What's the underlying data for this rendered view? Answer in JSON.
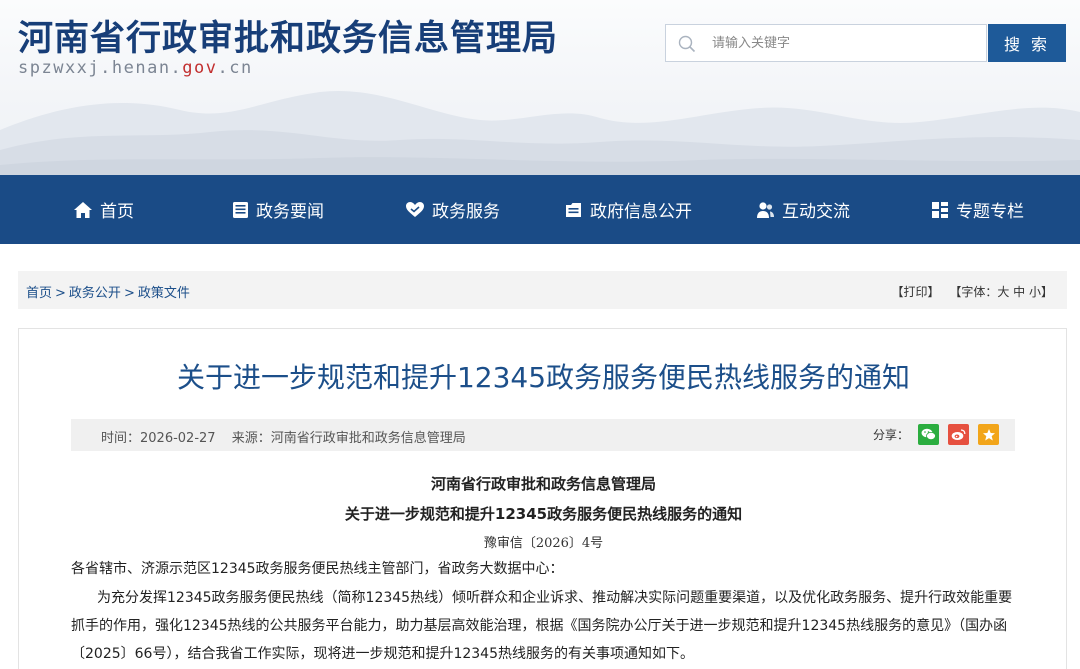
{
  "header": {
    "site_title": "河南省行政审批和政务信息管理局",
    "domain_prefix": "spzwxxj.henan.",
    "domain_gov": "gov",
    "domain_suffix": ".cn",
    "search_placeholder": "请输入关键字",
    "search_button": "搜 索"
  },
  "nav": {
    "items": [
      {
        "label": "首页",
        "icon": "home-icon"
      },
      {
        "label": "政务要闻",
        "icon": "news-icon"
      },
      {
        "label": "政务服务",
        "icon": "heart-hand-icon"
      },
      {
        "label": "政府信息公开",
        "icon": "document-icon"
      },
      {
        "label": "互动交流",
        "icon": "people-icon"
      },
      {
        "label": "专题专栏",
        "icon": "grid-icon"
      }
    ]
  },
  "breadcrumb": {
    "items": [
      "首页",
      "政务公开",
      "政策文件"
    ],
    "separator": ">"
  },
  "tools": {
    "print": "【打印】",
    "font_size": "【字体：大 中 小】"
  },
  "article": {
    "title": "关于进一步规范和提升12345政务服务便民热线服务的通知",
    "time": "时间：2026-02-27",
    "source": "来源：河南省行政审批和政务信息管理局",
    "share_label": "分享：",
    "doc_org": "河南省行政审批和政务信息管理局",
    "doc_title": "关于进一步规范和提升12345政务服务便民热线服务的通知",
    "doc_number": "豫审信〔2026〕4号",
    "salutation": "各省辖市、济源示范区12345政务服务便民热线主管部门，省政务大数据中心：",
    "body_line1": "为充分发挥12345政务服务便民热线（简称12345热线）倾听群众和企业诉求、推动解决实际问题重要渠道，以及优化政务服务、提升行政效能重要",
    "body_line2": "抓手的作用，强化12345热线的公共服务平台能力，助力基层高效能治理，根据《国务院办公厅关于进一步规范和提升12345热线服务的意见》（国办函",
    "body_line3": "〔2025〕66号），结合我省工作实际，现将进一步规范和提升12345热线服务的有关事项通知如下。"
  },
  "colors": {
    "nav_bg": "#1a4b86",
    "title_blue": "#1c4f8a",
    "search_button_bg": "#1e5a99",
    "wechat": "#2bad3f",
    "weibo": "#e6503f",
    "favorite": "#f2a51a"
  }
}
